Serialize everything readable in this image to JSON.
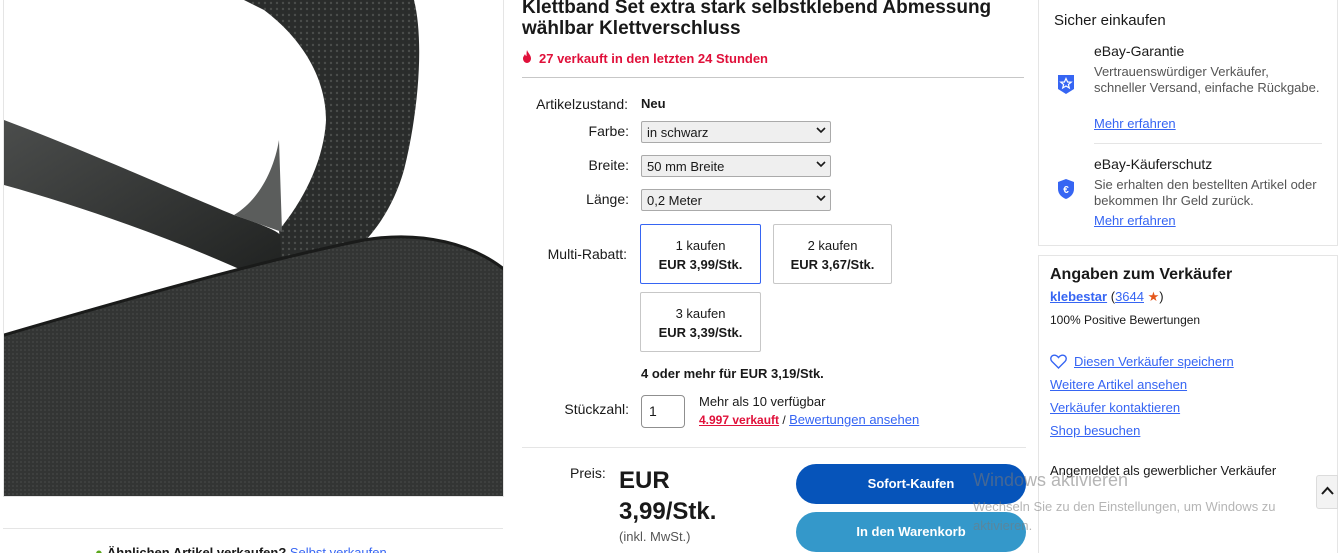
{
  "listing": {
    "title": "Klettband Set extra stark selbstklebend Abmessung wählbar Klettverschluss",
    "sold_notice": "27 verkauft in den letzten 24 Stunden",
    "image_alt": "Schwarzes Klettband"
  },
  "attributes": {
    "condition_label": "Artikelzustand:",
    "condition_value": "Neu",
    "color_label": "Farbe:",
    "color_value": "in schwarz",
    "width_label": "Breite:",
    "width_value": "50 mm Breite",
    "length_label": "Länge:",
    "length_value": "0,2 Meter"
  },
  "multi_discount": {
    "label": "Multi-Rabatt:",
    "tiers": [
      {
        "qty": "1 kaufen",
        "price": "EUR 3,99/Stk.",
        "selected": true
      },
      {
        "qty": "2 kaufen",
        "price": "EUR 3,67/Stk.",
        "selected": false
      },
      {
        "qty": "3 kaufen",
        "price": "EUR 3,39/Stk.",
        "selected": false
      }
    ],
    "more": "4 oder mehr für EUR 3,19/Stk."
  },
  "quantity": {
    "label": "Stückzahl:",
    "value": "1",
    "available": "Mehr als 10 verfügbar",
    "sold_count": "4.997 verkauft",
    "separator": "/",
    "reviews_link": "Bewertungen ansehen"
  },
  "price": {
    "label": "Preis:",
    "value_line1": "EUR",
    "value_line2": "3,99/Stk.",
    "tax": "(inkl. MwSt.)"
  },
  "actions": {
    "buy_now": "Sofort-Kaufen",
    "add_to_cart": "In den Warenkorb"
  },
  "safe_shopping": {
    "title": "Sicher einkaufen",
    "guarantee_title": "eBay-Garantie",
    "guarantee_text": "Vertrauenswürdiger Verkäufer, schneller Versand, einfache Rückgabe.",
    "guarantee_link": "Mehr erfahren",
    "protection_title": "eBay-Käuferschutz",
    "protection_text": "Sie erhalten den bestellten Artikel oder bekommen Ihr Geld zurück.",
    "protection_link": "Mehr erfahren",
    "brand_color": "#3665f3"
  },
  "seller": {
    "title": "Angaben zum Verkäufer",
    "name": "klebestar",
    "score_open": "(",
    "score": "3644",
    "score_close": ")",
    "positive": "100% Positive Bewertungen",
    "save_link": "Diesen Verkäufer speichern",
    "more_items": "Weitere Artikel ansehen",
    "contact": "Verkäufer kontaktieren",
    "shop": "Shop besuchen",
    "business": "Angemeldet als gewerblicher Verkäufer"
  },
  "similar": {
    "text": "Ähnlichen Artikel verkaufen?",
    "link": "Selbst verkaufen"
  },
  "windows_watermark": {
    "line1": "Windows aktivieren",
    "line2": "Wechseln Sie zu den Einstellungen, um Windows zu aktivieren."
  }
}
